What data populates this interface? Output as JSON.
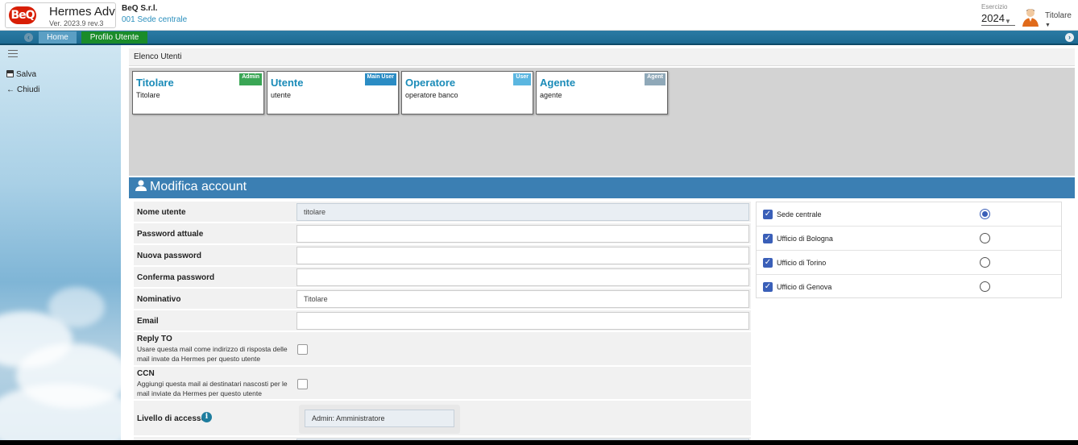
{
  "header": {
    "logo_text": "BeQ",
    "app_name": "Hermes Adv",
    "app_version": "Ver. 2023.9 rev.3",
    "company_name": "BeQ S.r.l.",
    "company_site": "001 Sede centrale",
    "esercizio_label": "Esercizio",
    "esercizio_year": "2024",
    "user_name": "Titolare"
  },
  "nav": {
    "tabs": [
      {
        "label": "Home"
      },
      {
        "label": "Profilo Utente"
      }
    ]
  },
  "sidebar": {
    "actions": [
      {
        "label": "Salva",
        "icon": "save-icon"
      },
      {
        "label": "Chiudi",
        "icon": "arrow-left-icon"
      }
    ]
  },
  "users_list": {
    "title": "Elenco Utenti",
    "cards": [
      {
        "title": "Titolare",
        "subtitle": "Titolare",
        "badge": "Admin",
        "badge_color": "#3aa655"
      },
      {
        "title": "Utente",
        "subtitle": "utente",
        "badge": "Main User",
        "badge_color": "#2b8cc4"
      },
      {
        "title": "Operatore",
        "subtitle": "operatore banco",
        "badge": "User",
        "badge_color": "#5bb6e0"
      },
      {
        "title": "Agente",
        "subtitle": "agente",
        "badge": "Agent",
        "badge_color": "#8fa8b8"
      }
    ]
  },
  "edit": {
    "title": "Modifica account",
    "fields": {
      "username_label": "Nome utente",
      "username_value": "titolare",
      "current_password_label": "Password attuale",
      "new_password_label": "Nuova password",
      "confirm_password_label": "Conferma password",
      "nominativo_label": "Nominativo",
      "nominativo_value": "Titolare",
      "email_label": "Email",
      "email_value": "",
      "reply_to_label": "Reply TO",
      "reply_to_desc": "Usare questa mail come indirizzo di risposta delle mail invate da Hermes per questo utente",
      "reply_to_checked": false,
      "ccn_label": "CCN",
      "ccn_desc": "Aggiungi questa mail ai destinatari nascosti per le mail inviate da Hermes per questo utente",
      "ccn_checked": false,
      "access_label": "Livello di accesso",
      "access_value": "Admin: Amministratore"
    },
    "offices": [
      {
        "label": "Sede centrale",
        "checked": true,
        "default": true
      },
      {
        "label": "Ufficio di Bologna",
        "checked": true,
        "default": false
      },
      {
        "label": "Ufficio di Torino",
        "checked": true,
        "default": false
      },
      {
        "label": "Ufficio di Genova",
        "checked": true,
        "default": false
      }
    ]
  },
  "colors": {
    "nav_bar": "#1d6a92",
    "active_tab": "#1a8c2a",
    "accent_blue": "#3b7fb3",
    "card_title": "#1a8bb8"
  }
}
